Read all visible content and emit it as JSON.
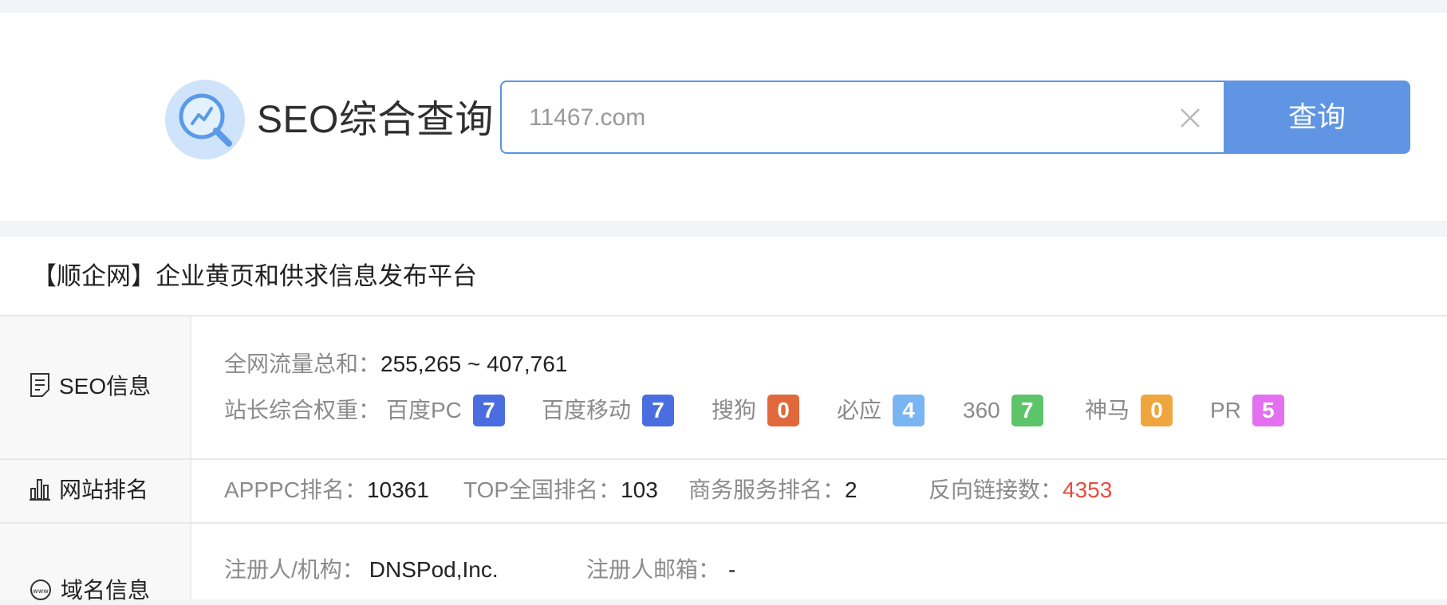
{
  "search": {
    "brand": "SEO综合查询",
    "value": "11467.com",
    "button": "查询"
  },
  "site": {
    "title": "【顺企网】企业黄页和供求信息发布平台"
  },
  "seo_info": {
    "heading": "SEO信息",
    "traffic_label": "全网流量总和：",
    "traffic_value": "255,265 ~ 407,761",
    "weight_label": "站长综合权重：",
    "weights": [
      {
        "name": "百度PC",
        "value": "7",
        "color": "#4a6ee0"
      },
      {
        "name": "百度移动",
        "value": "7",
        "color": "#4a6ee0"
      },
      {
        "name": "搜狗",
        "value": "0",
        "color": "#e0683a"
      },
      {
        "name": "必应",
        "value": "4",
        "color": "#79b5f3"
      },
      {
        "name": "360",
        "value": "7",
        "color": "#5ec46a"
      },
      {
        "name": "神马",
        "value": "0",
        "color": "#f0a63e"
      },
      {
        "name": "PR",
        "value": "5",
        "color": "#e370f0"
      }
    ]
  },
  "ranking": {
    "heading": "网站排名",
    "apppc_label": "APPPC排名：",
    "apppc_value": "10361",
    "top_label": "TOP全国排名：",
    "top_value": "103",
    "biz_label": "商务服务排名：",
    "biz_value": "2",
    "backlinks_label": "反向链接数：",
    "backlinks_value": "4353"
  },
  "domain": {
    "heading": "域名信息",
    "registrant_label": "注册人/机构：",
    "registrant_value": "DNSPod,Inc.",
    "email_label": "注册人邮箱：",
    "email_value": "-"
  },
  "icons": [
    "search-chart-icon",
    "clear-icon",
    "document-icon",
    "bar-chart-icon",
    "www-icon"
  ]
}
